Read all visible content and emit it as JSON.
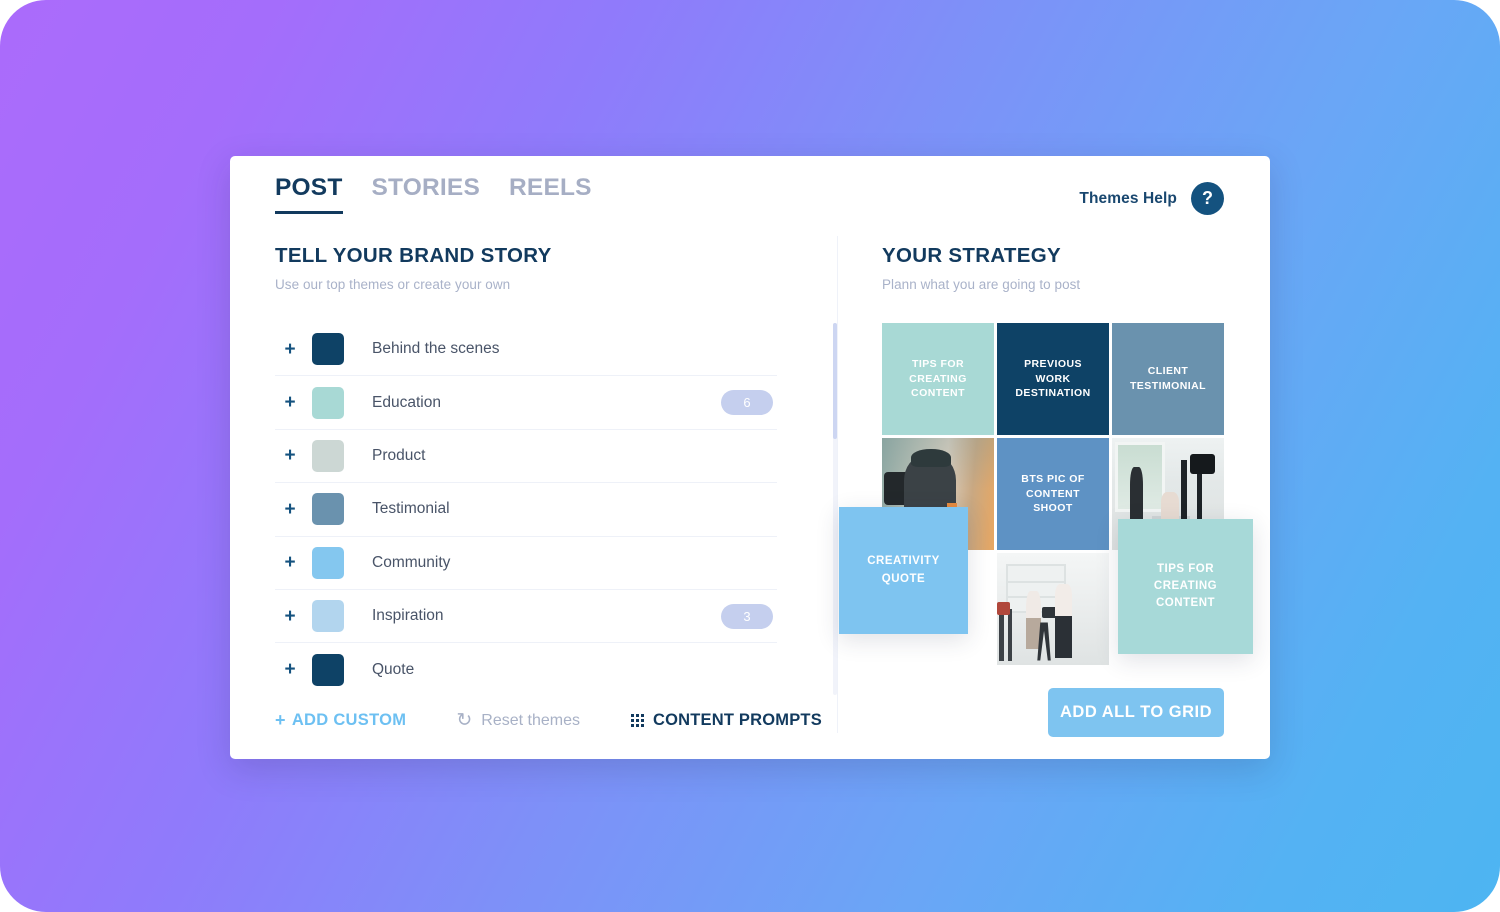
{
  "background": {
    "gradient_from": "#ab6bfb",
    "gradient_to": "#4db5f2"
  },
  "tabs": [
    {
      "label": "POST",
      "active": true
    },
    {
      "label": "STORIES",
      "active": false
    },
    {
      "label": "REELS",
      "active": false
    }
  ],
  "header": {
    "themes_help_label": "Themes Help",
    "help_badge": "?"
  },
  "left_panel": {
    "title": "TELL YOUR BRAND STORY",
    "subtitle": "Use our top themes or create your own",
    "themes": [
      {
        "name": "Behind the scenes",
        "color": "#0e4266",
        "count": ""
      },
      {
        "name": "Education",
        "color": "#a8d9d5",
        "count": "6"
      },
      {
        "name": "Product",
        "color": "#ccd7d4",
        "count": ""
      },
      {
        "name": "Testimonial",
        "color": "#6a92ae",
        "count": ""
      },
      {
        "name": "Community",
        "color": "#84c7ef",
        "count": ""
      },
      {
        "name": "Inspiration",
        "color": "#b2d5ee",
        "count": "3"
      },
      {
        "name": "Quote",
        "color": "#0e4266",
        "count": ""
      }
    ],
    "actions": {
      "add_custom": "ADD CUSTOM",
      "add_custom_plus": "+",
      "reset_themes": "Reset themes",
      "reset_glyph": "↻",
      "content_prompts": "CONTENT PROMPTS"
    }
  },
  "right_panel": {
    "title": "YOUR STRATEGY",
    "subtitle": "Plann what you are going to post",
    "grid": [
      {
        "kind": "theme",
        "text": "TIPS FOR\nCREATING\nCONTENT",
        "color": "#a8d9d5"
      },
      {
        "kind": "theme",
        "text": "PREVIOUS\nWORK\nDESTINATION",
        "color": "#0e4266"
      },
      {
        "kind": "theme",
        "text": "CLIENT\nTESTIMONIAL",
        "color": "#6a92ae"
      },
      {
        "kind": "photo",
        "text": "",
        "photo": "photo-a"
      },
      {
        "kind": "theme",
        "text": "BTS PIC OF\nCONTENT\nSHOOT",
        "color": "#5e92c4"
      },
      {
        "kind": "photo",
        "text": "",
        "photo": "photo-b"
      },
      {
        "kind": "empty",
        "text": "",
        "color": "#ffffff"
      },
      {
        "kind": "photo",
        "text": "",
        "photo": "photo-c"
      },
      {
        "kind": "empty",
        "text": "",
        "color": "#ffffff"
      }
    ],
    "floating_tiles": [
      {
        "text": "CREATIVITY\nQUOTE",
        "color": "#7ec4f0"
      },
      {
        "text": "TIPS FOR\nCREATING\nCONTENT",
        "color": "#a7d9d8"
      }
    ],
    "add_all_button": "ADD ALL TO GRID"
  }
}
